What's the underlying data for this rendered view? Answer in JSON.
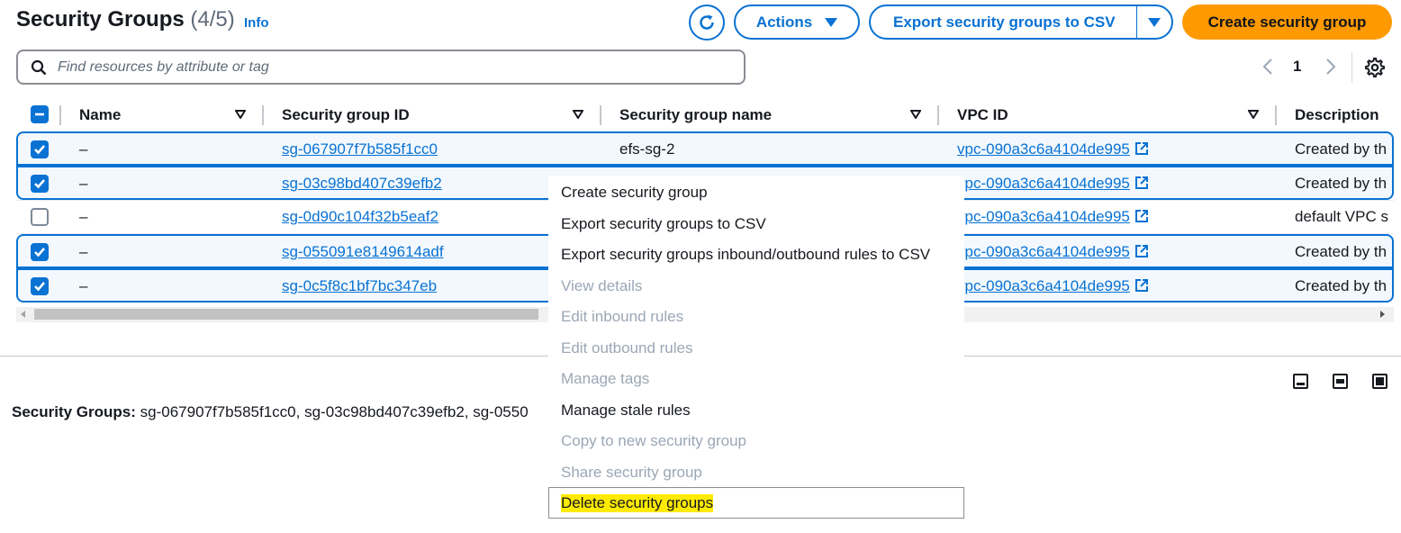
{
  "header": {
    "title": "Security Groups",
    "count": "(4/5)",
    "info": "Info",
    "actions_label": "Actions",
    "export_label": "Export security groups to CSV",
    "create_label": "Create security group"
  },
  "search": {
    "placeholder": "Find resources by attribute or tag"
  },
  "pagination": {
    "page": "1"
  },
  "table": {
    "columns": [
      "Name",
      "Security group ID",
      "Security group name",
      "VPC ID",
      "Description"
    ],
    "rows": [
      {
        "selected": true,
        "name": "–",
        "sg_id": "sg-067907f7b585f1cc0",
        "sg_name": "efs-sg-2",
        "vpc_id": "vpc-090a3c6a4104de995",
        "description": "Created by th"
      },
      {
        "selected": true,
        "name": "–",
        "sg_id": "sg-03c98bd407c39efb2",
        "sg_name": "",
        "vpc_id": "vpc-090a3c6a4104de995",
        "description": "Created by th"
      },
      {
        "selected": false,
        "name": "–",
        "sg_id": "sg-0d90c104f32b5eaf2",
        "sg_name": "",
        "vpc_id": "vpc-090a3c6a4104de995",
        "description": "default VPC s"
      },
      {
        "selected": true,
        "name": "–",
        "sg_id": "sg-055091e8149614adf",
        "sg_name": "",
        "vpc_id": "vpc-090a3c6a4104de995",
        "description": "Created by th"
      },
      {
        "selected": true,
        "name": "–",
        "sg_id": "sg-0c5f8c1bf7bc347eb",
        "sg_name": "",
        "vpc_id": "vpc-090a3c6a4104de995",
        "description": "Created by th"
      }
    ]
  },
  "details": {
    "label": "Security Groups:",
    "value": "sg-067907f7b585f1cc0, sg-03c98bd407c39efb2, sg-0550"
  },
  "menu": {
    "items": [
      {
        "label": "Create security group",
        "disabled": false
      },
      {
        "label": "Export security groups to CSV",
        "disabled": false
      },
      {
        "label": "Export security groups inbound/outbound rules to CSV",
        "disabled": false
      },
      {
        "label": "View details",
        "disabled": true
      },
      {
        "label": "Edit inbound rules",
        "disabled": true
      },
      {
        "label": "Edit outbound rules",
        "disabled": true
      },
      {
        "label": "Manage tags",
        "disabled": true
      },
      {
        "label": "Manage stale rules",
        "disabled": false
      },
      {
        "label": "Copy to new security group",
        "disabled": true
      },
      {
        "label": "Share security group",
        "disabled": true
      },
      {
        "label": "Delete security groups",
        "disabled": false,
        "highlighted": true
      }
    ]
  },
  "colors": {
    "accent": "#0972d3",
    "primary_button": "#ff9900",
    "highlight": "#ffeb00",
    "disabled_text": "#9ba7b6"
  }
}
